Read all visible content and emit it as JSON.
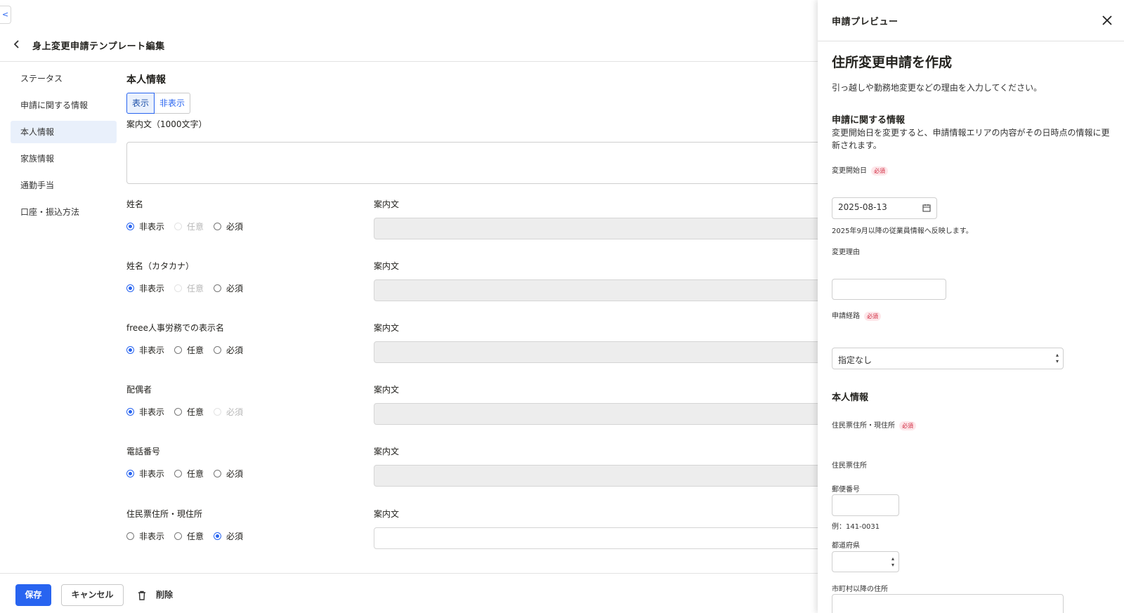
{
  "app": {
    "sidebar_toggle_label": "<",
    "page_title": "身上変更申請テンプレート編集",
    "back_label": "<"
  },
  "sidebar": {
    "items": [
      {
        "label": "ステータス"
      },
      {
        "label": "申請に関する情報"
      },
      {
        "label": "本人情報",
        "active": true
      },
      {
        "label": "家族情報"
      },
      {
        "label": "通勤手当"
      },
      {
        "label": "口座・振込方法"
      }
    ]
  },
  "main": {
    "section_title": "本人情報",
    "visibility_toggle": {
      "show": "表示",
      "hide": "非表示",
      "selected": "表示"
    },
    "guide_label": "案内文（1000文字）",
    "guide_value": "",
    "option_labels": {
      "hidden": "非表示",
      "optional": "任意",
      "required": "必須"
    },
    "guide_col_label": "案内文",
    "fields": [
      {
        "name": "姓名",
        "selected": "hidden",
        "disabled": "optional",
        "guide": ""
      },
      {
        "name": "姓名（カタカナ）",
        "selected": "hidden",
        "disabled": "optional",
        "guide": ""
      },
      {
        "name": "freee人事労務での表示名",
        "selected": "hidden",
        "disabled": "",
        "guide": ""
      },
      {
        "name": "配偶者",
        "selected": "hidden",
        "disabled": "required",
        "guide": ""
      },
      {
        "name": "電話番号",
        "selected": "hidden",
        "disabled": "",
        "guide": ""
      },
      {
        "name": "住民票住所・現住所",
        "selected": "required",
        "disabled": "",
        "guide": ""
      }
    ]
  },
  "footer": {
    "save": "保存",
    "cancel": "キャンセル",
    "delete": "削除"
  },
  "preview": {
    "panel_title": "申請プレビュー",
    "close_label": "✕",
    "form_title": "住所変更申請を作成",
    "form_description": "引っ越しや勤務地変更などの理由を入力してください。",
    "request_info": {
      "heading": "申請に関する情報",
      "note": "変更開始日を変更すると、申請情報エリアの内容がその日時点の情報に更新されます。",
      "start_date_label": "変更開始日",
      "required_badge": "必須",
      "start_date_value": "2025-08-13",
      "start_date_hint": "2025年9月以降の従業員情報へ反映します。",
      "reason_label": "変更理由",
      "reason_value": "",
      "route_label": "申請経路",
      "route_value": "指定なし"
    },
    "personal": {
      "heading": "本人情報",
      "address_label": "住民票住所・現住所",
      "resident_address_label": "住民票住所",
      "postal_label": "郵便番号",
      "postal_value": "",
      "postal_hint": "例：141-0031",
      "prefecture_label": "都道府県",
      "prefecture_value": "",
      "city_label": "市町村以降の住所",
      "city_value": ""
    }
  },
  "colors": {
    "accent": "#2864f0",
    "nav_active_bg": "#e9f0fb",
    "required_badge_bg": "#fde7ea",
    "required_badge_text": "#d0243b",
    "disabled_input_bg": "#ededed"
  }
}
